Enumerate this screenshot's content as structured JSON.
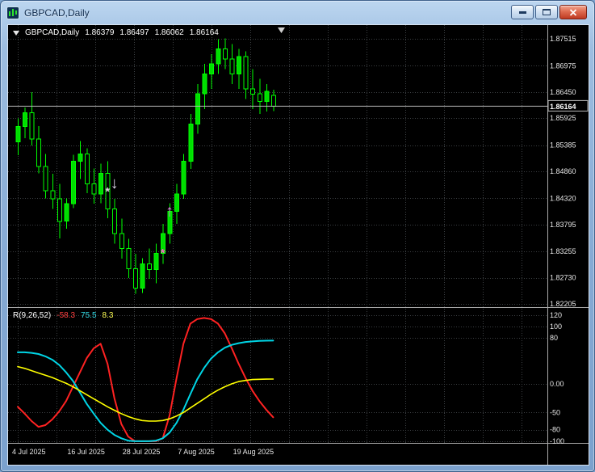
{
  "titlebar": {
    "title": "GBPCAD,Daily"
  },
  "chart_header": {
    "symbol": "GBPCAD,Daily",
    "open": "1.86379",
    "high": "1.86497",
    "low": "1.86062",
    "close": "1.86164"
  },
  "indicator_label": {
    "name": "R(9,26,52)",
    "values": [
      {
        "text": "-58.3",
        "color": "#ff4040"
      },
      {
        "text": "75.5",
        "color": "#35dde8"
      },
      {
        "text": "8.3",
        "color": "#ffff55"
      }
    ]
  },
  "price_axis": {
    "current": {
      "value": 1.86164,
      "label": "1.86164"
    }
  },
  "colors": {
    "background": "#000000",
    "grid": "#3c4043",
    "bull": "#00dd00",
    "bear": "#000000",
    "candle_outline": "#00ff00",
    "axis_text": "#e6e6e6",
    "separator": "#aaaaaa",
    "current_price_line": "#b8b8b8",
    "shift_marker": "#cfcfcf"
  },
  "chart_data": [
    {
      "type": "candlestick",
      "title": "GBPCAD Daily",
      "ylim": [
        1.8214,
        1.8779
      ],
      "y_ticks": [
        {
          "value": 1.87515,
          "label": "1.87515"
        },
        {
          "value": 1.86975,
          "label": "1.86975"
        },
        {
          "value": 1.8645,
          "label": "1.86450"
        },
        {
          "value": 1.85925,
          "label": "1.85925"
        },
        {
          "value": 1.85385,
          "label": "1.85385"
        },
        {
          "value": 1.8486,
          "label": "1.84860"
        },
        {
          "value": 1.8432,
          "label": "1.84320"
        },
        {
          "value": 1.83795,
          "label": "1.83795"
        },
        {
          "value": 1.83255,
          "label": "1.83255"
        },
        {
          "value": 1.8273,
          "label": "1.82730"
        },
        {
          "value": 1.82205,
          "label": "1.82205"
        }
      ],
      "x_labels": [
        "4 Jul 2025",
        "16 Jul 2025",
        "28 Jul 2025",
        "7 Aug 2025",
        "19 Aug 2025"
      ],
      "x_label_indices": [
        0,
        8,
        16,
        24,
        32
      ],
      "candles": [
        [
          1.8545,
          1.8592,
          1.8518,
          1.8576
        ],
        [
          1.8576,
          1.8614,
          1.8552,
          1.8603
        ],
        [
          1.8603,
          1.8645,
          1.8538,
          1.8551
        ],
        [
          1.8551,
          1.8577,
          1.8482,
          1.8496
        ],
        [
          1.8496,
          1.8521,
          1.8432,
          1.8447
        ],
        [
          1.8447,
          1.8481,
          1.8411,
          1.8431
        ],
        [
          1.8431,
          1.8461,
          1.8352,
          1.8386
        ],
        [
          1.8386,
          1.8432,
          1.8371,
          1.8421
        ],
        [
          1.8421,
          1.8519,
          1.8412,
          1.8506
        ],
        [
          1.8506,
          1.8547,
          1.8471,
          1.8521
        ],
        [
          1.8521,
          1.8532,
          1.8442,
          1.8461
        ],
        [
          1.8461,
          1.8492,
          1.8421,
          1.8441
        ],
        [
          1.8441,
          1.8501,
          1.8422,
          1.8482
        ],
        [
          1.8482,
          1.8506,
          1.8392,
          1.8411
        ],
        [
          1.8411,
          1.8431,
          1.8341,
          1.8361
        ],
        [
          1.8361,
          1.8391,
          1.8311,
          1.8331
        ],
        [
          1.8331,
          1.8351,
          1.8272,
          1.8291
        ],
        [
          1.8291,
          1.8321,
          1.8241,
          1.8252
        ],
        [
          1.8252,
          1.8312,
          1.8242,
          1.8301
        ],
        [
          1.8301,
          1.8331,
          1.8271,
          1.8289
        ],
        [
          1.8289,
          1.8341,
          1.8262,
          1.8322
        ],
        [
          1.8322,
          1.8381,
          1.8301,
          1.8361
        ],
        [
          1.8361,
          1.8422,
          1.8341,
          1.8406
        ],
        [
          1.8406,
          1.8461,
          1.8381,
          1.8441
        ],
        [
          1.8441,
          1.8521,
          1.8431,
          1.8506
        ],
        [
          1.8506,
          1.8601,
          1.8491,
          1.8581
        ],
        [
          1.8581,
          1.8661,
          1.8561,
          1.8641
        ],
        [
          1.8641,
          1.8701,
          1.8611,
          1.8681
        ],
        [
          1.8681,
          1.8721,
          1.8651,
          1.8701
        ],
        [
          1.8701,
          1.8751,
          1.8681,
          1.8731
        ],
        [
          1.8731,
          1.8752,
          1.8691,
          1.8711
        ],
        [
          1.8711,
          1.8741,
          1.8661,
          1.8681
        ],
        [
          1.8681,
          1.8731,
          1.8651,
          1.8716
        ],
        [
          1.8716,
          1.8726,
          1.8631,
          1.8651
        ],
        [
          1.8651,
          1.8691,
          1.8611,
          1.8641
        ],
        [
          1.8641,
          1.8671,
          1.8601,
          1.8626
        ],
        [
          1.8626,
          1.8661,
          1.8606,
          1.8646
        ],
        [
          1.86379,
          1.86497,
          1.86062,
          1.86164
        ]
      ],
      "markers": [
        {
          "index": 13,
          "price": 1.8438,
          "glyph": "*",
          "color": "#e8d4e8",
          "size": 14,
          "name": "star-marker-icon"
        },
        {
          "index": 14,
          "price": 1.8452,
          "glyph": "↓",
          "color": "#d4cede",
          "size": 20,
          "name": "down-arrow-icon"
        },
        {
          "index": 21,
          "price": 1.8315,
          "glyph": "*",
          "color": "#ff63c9",
          "size": 14,
          "name": "star-marker-icon"
        },
        {
          "index": 22,
          "price": 1.8396,
          "glyph": "↑",
          "color": "#e07ae0",
          "size": 20,
          "name": "up-arrow-icon"
        }
      ]
    },
    {
      "type": "line",
      "title": "R(9,26,52)",
      "ylim": [
        -103,
        131
      ],
      "levels": [
        {
          "value": 120,
          "label": "120"
        },
        {
          "value": 100,
          "label": "100"
        },
        {
          "value": 80,
          "label": "80"
        },
        {
          "value": 0,
          "label": "0.00"
        },
        {
          "value": -50,
          "label": "-50"
        },
        {
          "value": -80,
          "label": "-80"
        },
        {
          "value": -100,
          "label": "-100"
        }
      ],
      "series": [
        {
          "name": "fast-line",
          "color": "#ff2222",
          "width": 2,
          "values": [
            -40,
            -52,
            -65,
            -75,
            -72,
            -62,
            -48,
            -30,
            -5,
            20,
            45,
            62,
            70,
            35,
            -25,
            -70,
            -92,
            -100,
            -100,
            -100,
            -100,
            -95,
            -55,
            10,
            70,
            105,
            113,
            115,
            113,
            105,
            88,
            62,
            35,
            10,
            -12,
            -30,
            -45,
            -58.3
          ]
        },
        {
          "name": "slow-line",
          "color": "#00d5e5",
          "width": 2,
          "values": [
            55,
            55,
            54,
            52,
            48,
            42,
            33,
            20,
            5,
            -15,
            -35,
            -52,
            -68,
            -80,
            -89,
            -95,
            -99,
            -100,
            -100,
            -100,
            -99,
            -95,
            -85,
            -68,
            -45,
            -18,
            8,
            28,
            44,
            55,
            63,
            68,
            71,
            73,
            74,
            75,
            75.3,
            75.5
          ]
        },
        {
          "name": "signal-line",
          "color": "#ffff00",
          "width": 1.6,
          "values": [
            30,
            27,
            23,
            19,
            15,
            11,
            6,
            1,
            -5,
            -12,
            -19,
            -26,
            -33,
            -40,
            -46,
            -52,
            -57,
            -61,
            -64,
            -65,
            -65,
            -64,
            -61,
            -56,
            -50,
            -42,
            -34,
            -26,
            -18,
            -11,
            -5,
            0,
            4,
            6,
            7.5,
            8,
            8.2,
            8.3
          ]
        }
      ]
    }
  ]
}
